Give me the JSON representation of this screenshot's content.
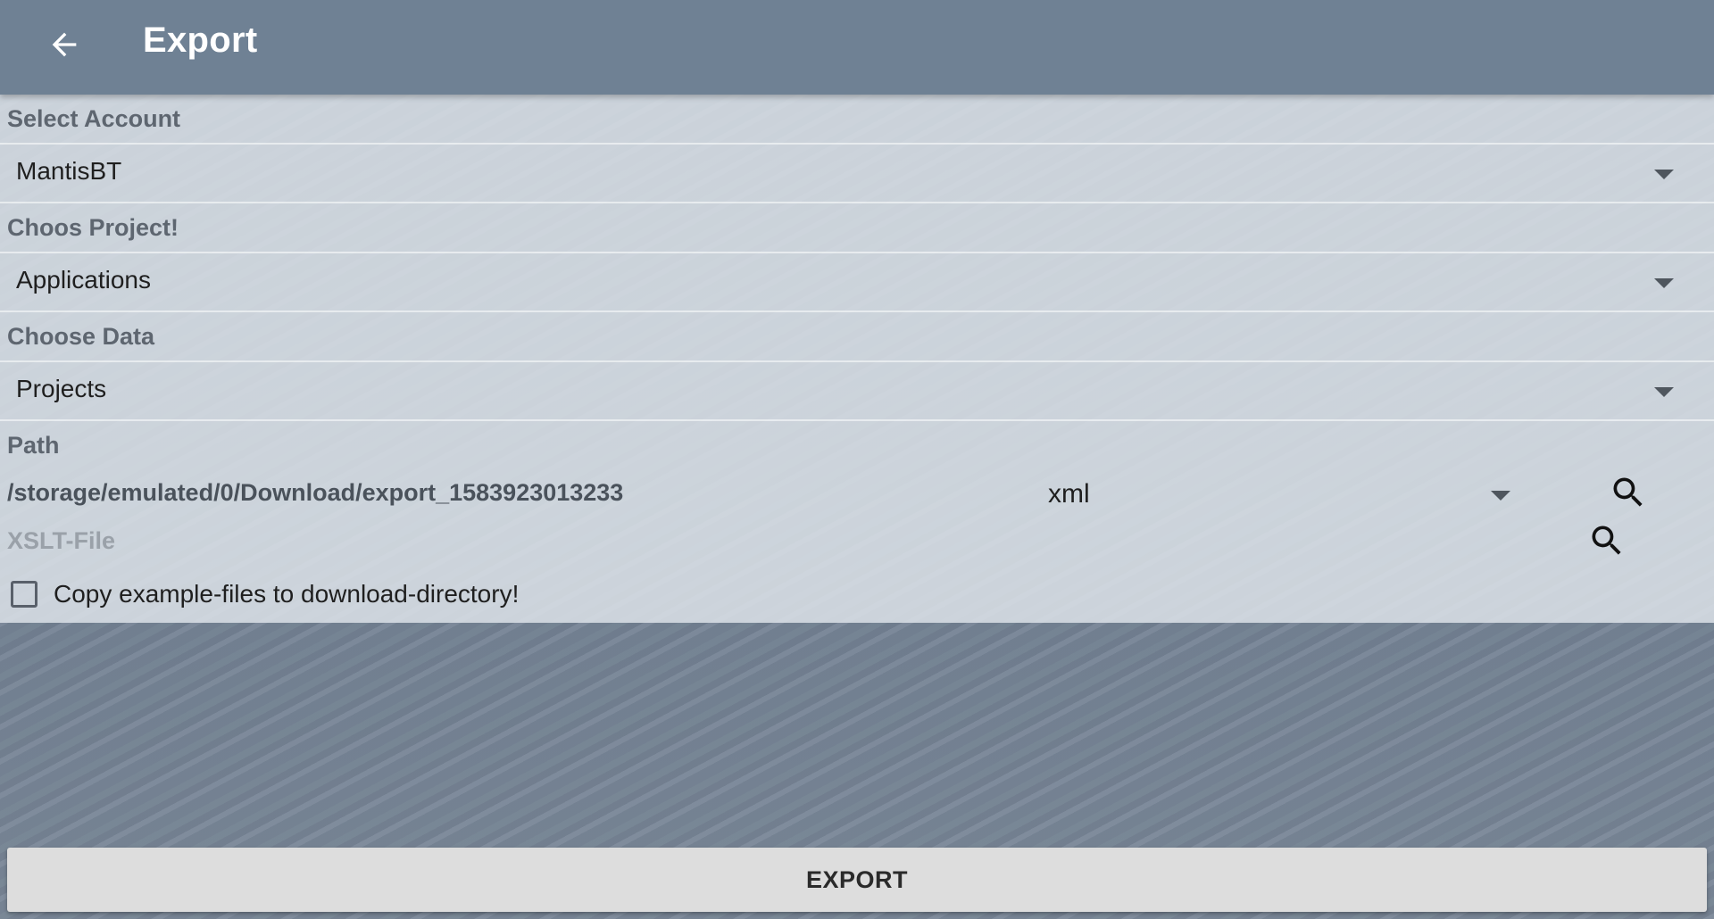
{
  "appbar": {
    "title": "Export",
    "back_icon": "arrow-back-icon"
  },
  "account": {
    "label": "Select Account",
    "value": "MantisBT"
  },
  "project": {
    "label": "Choos Project!",
    "value": "Applications"
  },
  "data": {
    "label": "Choose Data",
    "value": "Projects"
  },
  "path": {
    "label": "Path",
    "value": "/storage/emulated/0/Download/export_1583923013233",
    "format": "xml",
    "search_icon": "search-icon"
  },
  "xslt": {
    "label": "XSLT-File",
    "search_icon": "search-icon"
  },
  "copy_examples": {
    "label": "Copy example-files to download-directory!",
    "checked": false
  },
  "export_button": {
    "label": "EXPORT"
  },
  "colors": {
    "appbar": "#6f8194",
    "panel": "#dee3e9",
    "button": "#dddddd",
    "title_text": "#ffffff"
  }
}
